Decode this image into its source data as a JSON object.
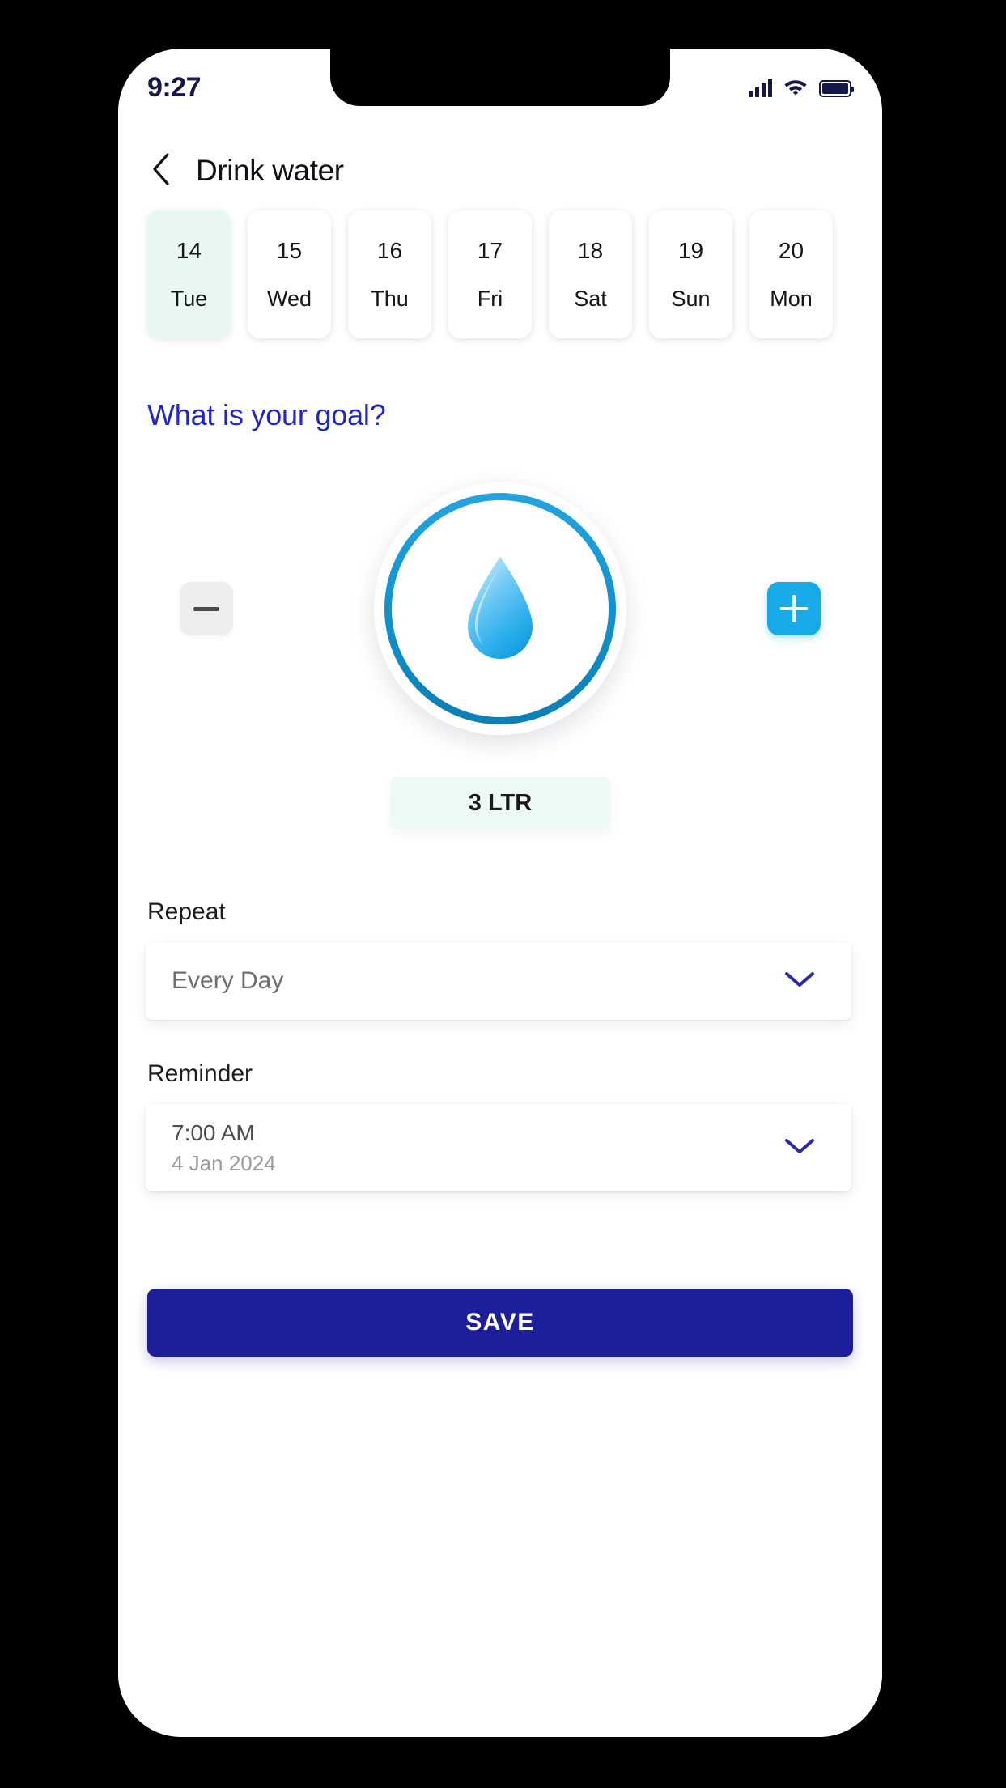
{
  "status_bar": {
    "time": "9:27",
    "icons": [
      "signal-icon",
      "wifi-icon",
      "battery-icon"
    ]
  },
  "header": {
    "back_icon": "chevron-left-icon",
    "title": "Drink water"
  },
  "date_strip": {
    "days": [
      {
        "num": "14",
        "dow": "Tue",
        "selected": true
      },
      {
        "num": "15",
        "dow": "Wed",
        "selected": false
      },
      {
        "num": "16",
        "dow": "Thu",
        "selected": false
      },
      {
        "num": "17",
        "dow": "Fri",
        "selected": false
      },
      {
        "num": "18",
        "dow": "Sat",
        "selected": false
      },
      {
        "num": "19",
        "dow": "Sun",
        "selected": false
      },
      {
        "num": "20",
        "dow": "Mon",
        "selected": false
      }
    ]
  },
  "goal": {
    "heading": "What is your goal?",
    "decrement_icon": "minus-icon",
    "increment_icon": "plus-icon",
    "dial_icon": "water-droplet-icon",
    "value": "3 LTR"
  },
  "repeat": {
    "label": "Repeat",
    "value": "Every Day",
    "chevron_icon": "chevron-down-icon"
  },
  "reminder": {
    "label": "Reminder",
    "time": "7:00 AM",
    "date": "4 Jan 2024",
    "chevron_icon": "chevron-down-icon"
  },
  "actions": {
    "save_label": "SAVE"
  },
  "colors": {
    "accent_blue": "#17a9e8",
    "deep_indigo": "#1c1f99",
    "heading_blue": "#2326c7",
    "selected_mint": "#e8f7f4",
    "chip_mint": "#edf9f7",
    "ring_top": "#23a4e0",
    "ring_bottom": "#0b7fb4"
  }
}
